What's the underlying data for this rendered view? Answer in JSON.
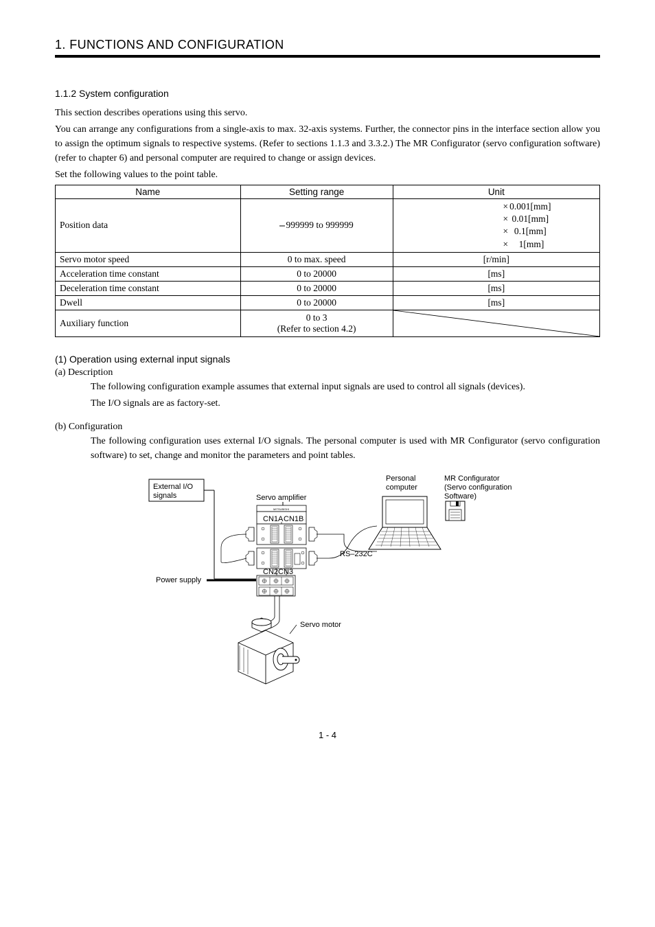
{
  "chapter": "1. FUNCTIONS AND CONFIGURATION",
  "section_heading": "1.1.2 System configuration",
  "intro1": "This section describes operations using this servo.",
  "intro2": "You can arrange any configurations from a single-axis to max. 32-axis systems. Further, the connector pins in the interface section allow you to assign the optimum signals to respective systems. (Refer to sections 1.1.3 and 3.3.2.) The MR Configurator (servo configuration software) (refer to chapter 6) and personal computer are required to change or assign devices.",
  "intro3": "Set the following values to the point table.",
  "headers": {
    "name": "Name",
    "range": "Setting range",
    "unit": "Unit"
  },
  "rows": {
    "pos": {
      "name": "Position data",
      "range": "999999 to 999999",
      "u1p": "×",
      "u1v": "0.001[mm]",
      "u2p": "×",
      "u2v": " 0.01[mm]",
      "u3p": "×",
      "u3v": "  0.1[mm]",
      "u4p": "×",
      "u4v": "    1[mm]"
    },
    "speed": {
      "name": "Servo motor speed",
      "range": "0 to max. speed",
      "unit": "[r/min]"
    },
    "accel": {
      "name": "Acceleration time constant",
      "range": "0 to 20000",
      "unit": "[ms]"
    },
    "decel": {
      "name": "Deceleration time constant",
      "range": "0 to 20000",
      "unit": "[ms]"
    },
    "dwell": {
      "name": "Dwell",
      "range": "0 to 20000",
      "unit": "[ms]"
    },
    "aux": {
      "name": "Auxiliary function",
      "range1": "0 to 3",
      "range2": "(Refer to section 4.2)"
    }
  },
  "sub_heading": "(1) Operation using external input signals",
  "a_label": "(a) Description",
  "a_text1": "The following configuration example assumes that external input signals are used to control all signals (devices).",
  "a_text2": "The I/O signals are as factory-set.",
  "b_label": "(b) Configuration",
  "b_text": "The following configuration uses external I/O signals. The personal computer is used with MR Configurator (servo configuration software) to set, change and monitor the parameters and point tables.",
  "diagram": {
    "ext_io1": "External I/O",
    "ext_io2": "signals",
    "servo_amp": "Servo amplifier",
    "pc1": "Personal",
    "pc2": "computer",
    "mr1": "MR Configurator",
    "mr2": "(Servo configuration",
    "mr3": "Software)",
    "cn1a": "CN1A",
    "cn1b": "CN1B",
    "cn2": "CN2",
    "cn3": "CN3",
    "rs232": "RS–232C",
    "power": "Power supply",
    "mfr": "MITSUBISHI",
    "servo_motor": "Servo motor"
  },
  "page_num": "1 -  4"
}
